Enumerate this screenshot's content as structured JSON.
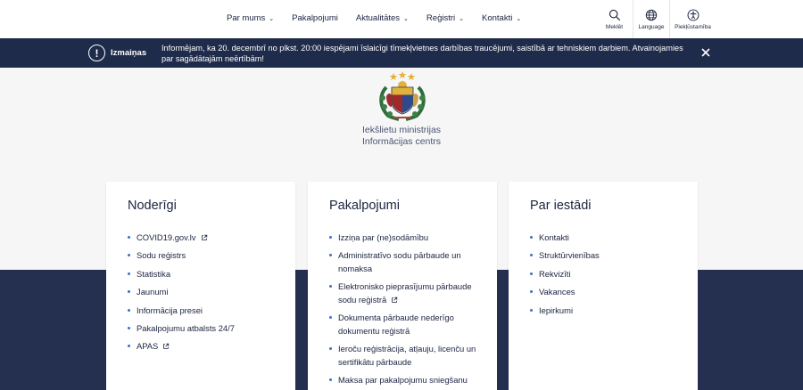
{
  "nav": {
    "items": [
      {
        "label": "Par mums",
        "has_dropdown": true
      },
      {
        "label": "Pakalpojumi",
        "has_dropdown": false
      },
      {
        "label": "Aktualitātes",
        "has_dropdown": true
      },
      {
        "label": "Reģistri",
        "has_dropdown": true
      },
      {
        "label": "Kontakti",
        "has_dropdown": true
      }
    ],
    "tools": {
      "search": "Meklēt",
      "language": "Language",
      "accessibility": "Piekļūstamība"
    }
  },
  "banner": {
    "label": "Izmaiņas",
    "text": "Informējam, ka 20. decembrī no plkst. 20:00 iespējami īslaicīgi tīmekļvietnes darbības traucējumi, saistībā ar tehniskiem darbiem. Atvainojamies par sagādātajām neērtībām!"
  },
  "org": {
    "line1": "Iekšlietu ministrijas",
    "line2": "Informācijas centrs"
  },
  "cards": [
    {
      "title": "Noderīgi",
      "items": [
        {
          "label": "COVID19.gov.lv",
          "external": true
        },
        {
          "label": "Sodu reģistrs",
          "external": false
        },
        {
          "label": "Statistika",
          "external": false
        },
        {
          "label": "Jaunumi",
          "external": false
        },
        {
          "label": "Informācija presei",
          "external": false
        },
        {
          "label": "Pakalpojumu atbalsts 24/7",
          "external": false
        },
        {
          "label": "APAS",
          "external": true
        }
      ]
    },
    {
      "title": "Pakalpojumi",
      "items": [
        {
          "label": "Izziņa par (ne)sodāmību",
          "external": false
        },
        {
          "label": "Administratīvo sodu pārbaude un nomaksa",
          "external": false
        },
        {
          "label": "Elektronisko pieprasījumu pārbaude sodu reģistrā",
          "external": true
        },
        {
          "label": "Dokumenta pārbaude nederīgo dokumentu reģistrā",
          "external": false
        },
        {
          "label": "Ieroču reģistrācija, atļauju, licenču un sertifikātu pārbaude",
          "external": false
        },
        {
          "label": "Maksa par pakalpojumu sniegšanu",
          "external": false
        }
      ]
    },
    {
      "title": "Par iestādi",
      "items": [
        {
          "label": "Kontakti",
          "external": false
        },
        {
          "label": "Struktūrvienības",
          "external": false
        },
        {
          "label": "Rekvizīti",
          "external": false
        },
        {
          "label": "Vakances",
          "external": false
        },
        {
          "label": "Iepirkumi",
          "external": false
        }
      ]
    }
  ],
  "colors": {
    "banner_bg": "#1f2b4a",
    "lower_band": "#252f50",
    "bullet": "#3d6ec6",
    "text": "#1b2440"
  }
}
